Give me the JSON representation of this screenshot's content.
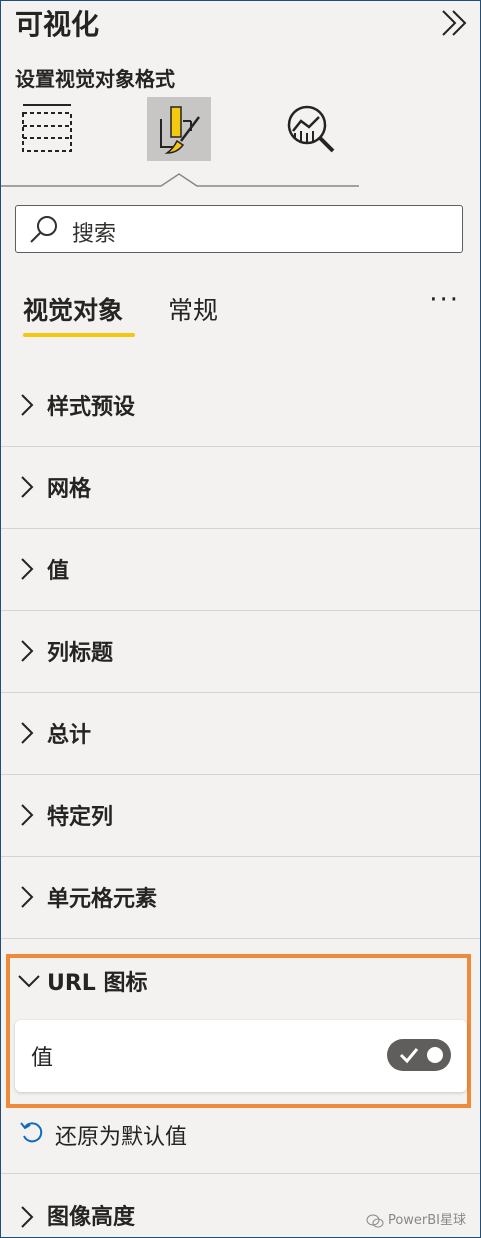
{
  "pane": {
    "title": "可视化",
    "subtitle": "设置视觉对象格式"
  },
  "toolbar": {
    "buttons": [
      {
        "icon": "build-visual-icon",
        "active": false
      },
      {
        "icon": "format-visual-icon",
        "active": true
      },
      {
        "icon": "analytics-icon",
        "active": false
      }
    ]
  },
  "search": {
    "placeholder": "搜索"
  },
  "tabs": {
    "visual": "视觉对象",
    "general": "常规",
    "more": "···"
  },
  "sections": [
    {
      "label": "样式预设",
      "expanded": false
    },
    {
      "label": "网格",
      "expanded": false
    },
    {
      "label": "值",
      "expanded": false
    },
    {
      "label": "列标题",
      "expanded": false
    },
    {
      "label": "总计",
      "expanded": false
    },
    {
      "label": "特定列",
      "expanded": false
    },
    {
      "label": "单元格元素",
      "expanded": false
    }
  ],
  "url_section": {
    "label": "URL 图标",
    "expanded": true,
    "value_label": "值",
    "toggle_on": true,
    "reset_label": "还原为默认值"
  },
  "last_section": {
    "label": "图像高度",
    "expanded": false
  },
  "watermark": {
    "text": "PowerBI星球"
  },
  "colors": {
    "accent_underline": "#f2c811",
    "highlight_border": "#ef8a3c",
    "pane_bg": "#f3f2f1",
    "frame_border": "#1f4e79"
  }
}
